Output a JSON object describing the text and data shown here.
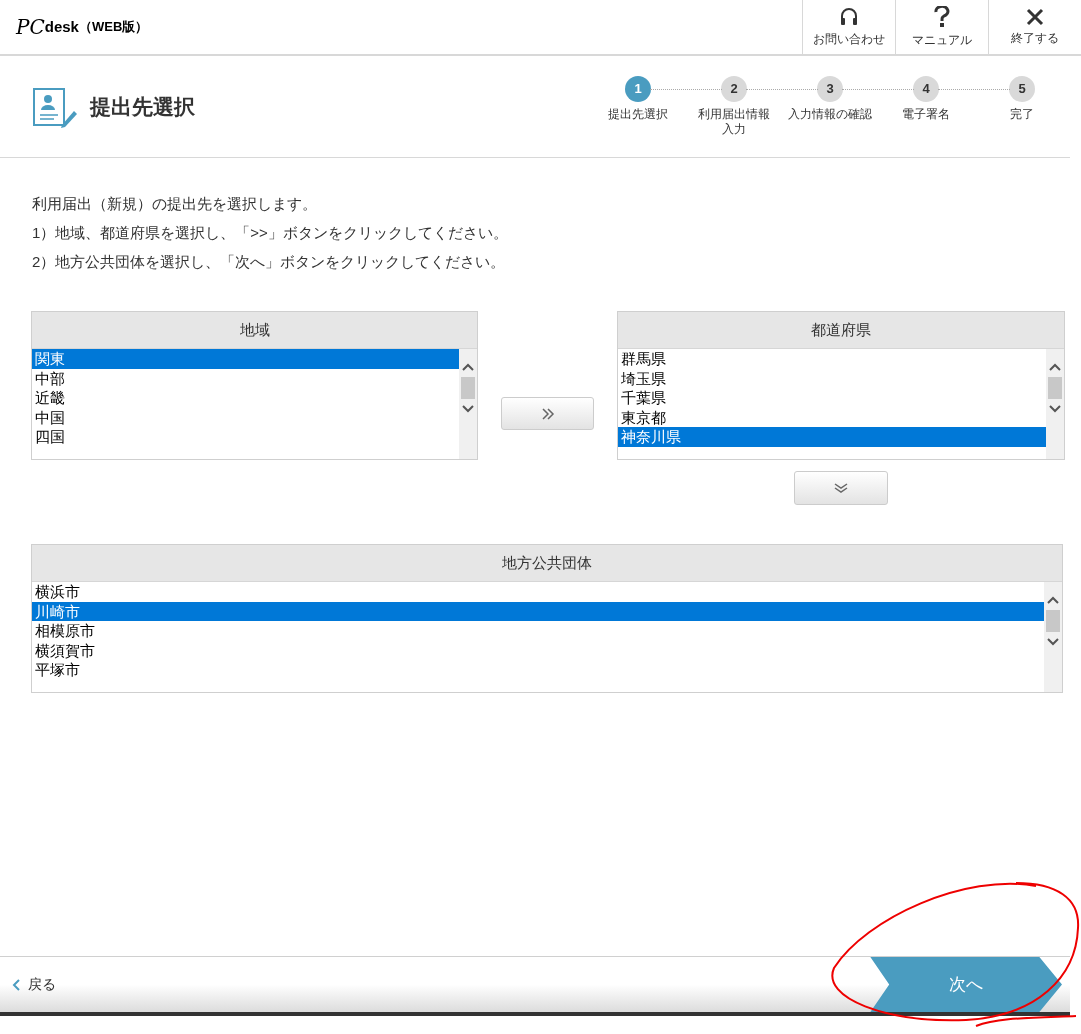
{
  "header": {
    "logo_mark": "PC",
    "logo_text": "desk",
    "edition": "（WEB版）",
    "buttons": [
      {
        "kind": "headset",
        "label": "お問い合わせ"
      },
      {
        "kind": "help",
        "label": "マニュアル"
      },
      {
        "kind": "close",
        "label": "終了する"
      }
    ]
  },
  "page_title": "提出先選択",
  "steps": [
    {
      "number": "1",
      "lines": [
        "提出先選択"
      ],
      "selected": true
    },
    {
      "number": "2",
      "lines": [
        "利用届出情報",
        "入力"
      ],
      "selected": false
    },
    {
      "number": "3",
      "lines": [
        "入力情報の確認"
      ],
      "selected": false
    },
    {
      "number": "4",
      "lines": [
        "電子署名"
      ],
      "selected": false
    },
    {
      "number": "5",
      "lines": [
        "完了"
      ],
      "selected": false
    }
  ],
  "instructions": [
    "利用届出（新規）の提出先を選択します。",
    "1）地域、都道府県を選択し、「>>」ボタンをクリックしてください。",
    "2）地方公共団体を選択し、「次へ」ボタンをクリックしてください。"
  ],
  "region_list": {
    "title": "地域",
    "items": [
      {
        "label": "関東",
        "selected": true
      },
      {
        "label": "中部",
        "selected": false
      },
      {
        "label": "近畿",
        "selected": false
      },
      {
        "label": "中国",
        "selected": false
      },
      {
        "label": "四国",
        "selected": false
      }
    ]
  },
  "prefecture_list": {
    "title": "都道府県",
    "items": [
      {
        "label": "群馬県",
        "selected": false
      },
      {
        "label": "埼玉県",
        "selected": false
      },
      {
        "label": "千葉県",
        "selected": false
      },
      {
        "label": "東京都",
        "selected": false
      },
      {
        "label": "神奈川県",
        "selected": true
      }
    ]
  },
  "municipality_list": {
    "title": "地方公共団体",
    "items": [
      {
        "label": "横浜市",
        "selected": false
      },
      {
        "label": "川崎市",
        "selected": true
      },
      {
        "label": "相模原市",
        "selected": false
      },
      {
        "label": "横須賀市",
        "selected": false
      },
      {
        "label": "平塚市",
        "selected": false
      }
    ]
  },
  "footer": {
    "back": "戻る",
    "next": "次へ"
  }
}
